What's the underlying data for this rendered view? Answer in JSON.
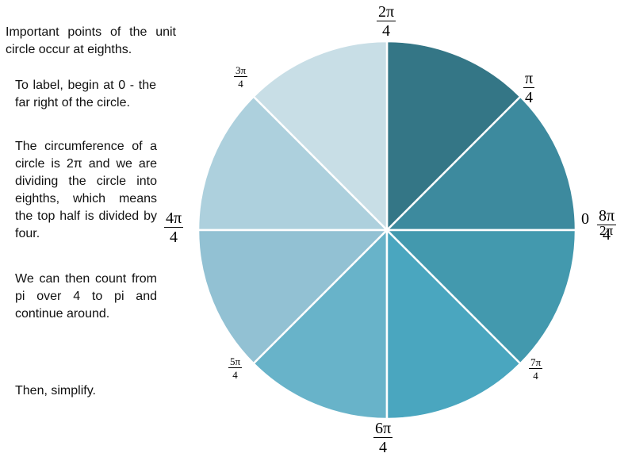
{
  "text": {
    "p1": "Important points of the unit circle occur at eighths.",
    "p2": "To label, begin at 0 - the far right of the circle.",
    "p3": "The circumference of a circle is 2π and we are dividing the circle into eighths, which means the top half is divided by four.",
    "p4": "We can then count from pi over 4 to pi and continue around.",
    "p5": "Then, simplify."
  },
  "labels": {
    "top": {
      "num": "2π",
      "den": "4"
    },
    "pi4": {
      "num": "π",
      "den": "4"
    },
    "zero": "0",
    "right": {
      "num": "8π",
      "den": "4",
      "overlap": "2π"
    },
    "threepi4": {
      "num": "3π",
      "den": "4"
    },
    "left": {
      "num": "4π",
      "den": "4"
    },
    "fivepi4": {
      "num": "5π",
      "den": "4"
    },
    "bottom": {
      "num": "6π",
      "den": "4"
    },
    "sevenpi4": {
      "num": "7π",
      "den": "4"
    }
  },
  "slice_colors": [
    "#3d8a9e",
    "#347686",
    "#c8dee6",
    "#add0dd",
    "#92c1d3",
    "#68b3c9",
    "#4aa6bf",
    "#4399ae"
  ]
}
